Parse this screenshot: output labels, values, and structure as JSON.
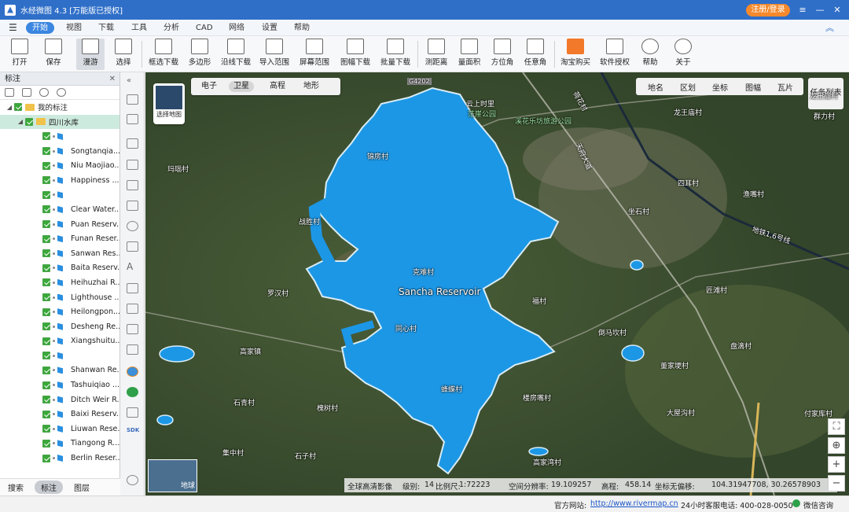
{
  "app": {
    "title": "水经微图 4.3 [万能版已授权]",
    "login": "注册/登录"
  },
  "menu": [
    "开始",
    "视图",
    "下载",
    "工具",
    "分析",
    "CAD",
    "网络",
    "设置",
    "帮助"
  ],
  "toolbar": [
    "打开",
    "保存",
    "漫游",
    "选择",
    "框选下载",
    "多边形",
    "沿线下载",
    "导入范围",
    "屏幕范围",
    "图幅下载",
    "批量下载",
    "测距离",
    "量面积",
    "方位角",
    "任意角",
    "淘宝购买",
    "软件授权",
    "帮助",
    "关于"
  ],
  "panel": {
    "title": "标注",
    "root": "我的标注",
    "group": "四川水库",
    "items": [
      "",
      "Songtanqia...",
      "Niu Maojiao...",
      "Happiness ...",
      "",
      "Clear Water...",
      "Puan Reserv...",
      "Funan Reser...",
      "Sanwan Res...",
      "Baita Reserv...",
      "Heihuzhai R...",
      "Lighthouse ...",
      "Heilongpon...",
      "Desheng Re...",
      "Xiangshuitu...",
      "",
      "Shanwan Re...",
      "Tashuiqiao ...",
      "Ditch Weir R...",
      "Baixi Reserv...",
      "Liuwan Rese...",
      "Tiangong R...",
      "Berlin Reser..."
    ],
    "tabs": [
      "搜索",
      "标注",
      "图层"
    ]
  },
  "map": {
    "tabs": [
      "电子",
      "卫星",
      "高程",
      "地形"
    ],
    "selectMap": "选择地图",
    "rightLinks": [
      "地名",
      "区划",
      "坐标",
      "图幅",
      "瓦片"
    ],
    "taskList": "任务列表",
    "globe": "地球",
    "reservoirLabel": "Sancha Reservoir",
    "places": [
      "G4202",
      "云上时里",
      "茫崖公园",
      "溪花乐坊旅游公园",
      "龙王庙村",
      "群力村",
      "四耳村",
      "渔嘴村",
      "坐石村",
      "地铁1,6号线",
      "锦房村",
      "玛瑙村",
      "战胜村",
      "克难村",
      "罗汉村",
      "同心村",
      "匠滩村",
      "福村",
      "倒马坎村",
      "盘滴村",
      "董家埂村",
      "高家镇",
      "石青村",
      "槐树村",
      "集中村",
      "石子村",
      "蜂蝶村",
      "楼房嘴村",
      "大屋沟村",
      "付家库村",
      "高家湾村",
      "天府大道",
      "荷花村",
      "龙王庙村"
    ],
    "status": {
      "a": "全球高清影像",
      "level_label": "级别:",
      "level": "14",
      "scale_label": "比例尺:",
      "scale": "1:72223",
      "res_label": "空间分辨率:",
      "res": "19.109257",
      "elev_label": "高程:",
      "elev": "458.14",
      "coord_label": "坐标无偏移:",
      "coord": "104.31947708, 30.26578903"
    }
  },
  "footer": {
    "site_label": "官方网站:",
    "site": "http://www.rivermap.cn",
    "phone": "24小时客服电话: 400-028-0050",
    "chat": "微信咨询"
  }
}
